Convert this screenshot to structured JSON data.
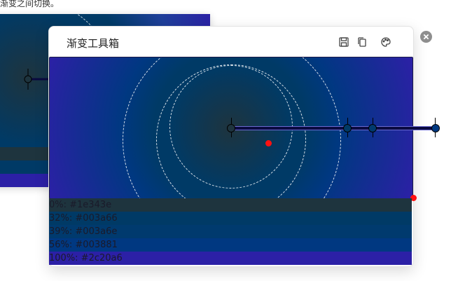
{
  "hint_text": "渐变之间切换。",
  "dialog": {
    "title": "渐变工具箱"
  },
  "tools": {
    "save": "save-icon",
    "copy": "copy-icon",
    "palette": "palette-icon",
    "close": "close-icon"
  },
  "gradient": {
    "stops": [
      {
        "label": "0%: #1e343e",
        "color": "#1e343e",
        "pos": 0
      },
      {
        "label": "32%: #003a66",
        "color": "#003a66",
        "pos": 32
      },
      {
        "label": "39%: #003a6e",
        "color": "#003a6e",
        "pos": 39
      },
      {
        "label": "56%: #003881",
        "color": "#003881",
        "pos": 56
      },
      {
        "label": "100%: #2c20a6",
        "color": "#2c20a6",
        "pos": 100
      }
    ]
  },
  "colors": {
    "marker_red": "#ff1111",
    "close_grey": "#8e8e8e"
  }
}
